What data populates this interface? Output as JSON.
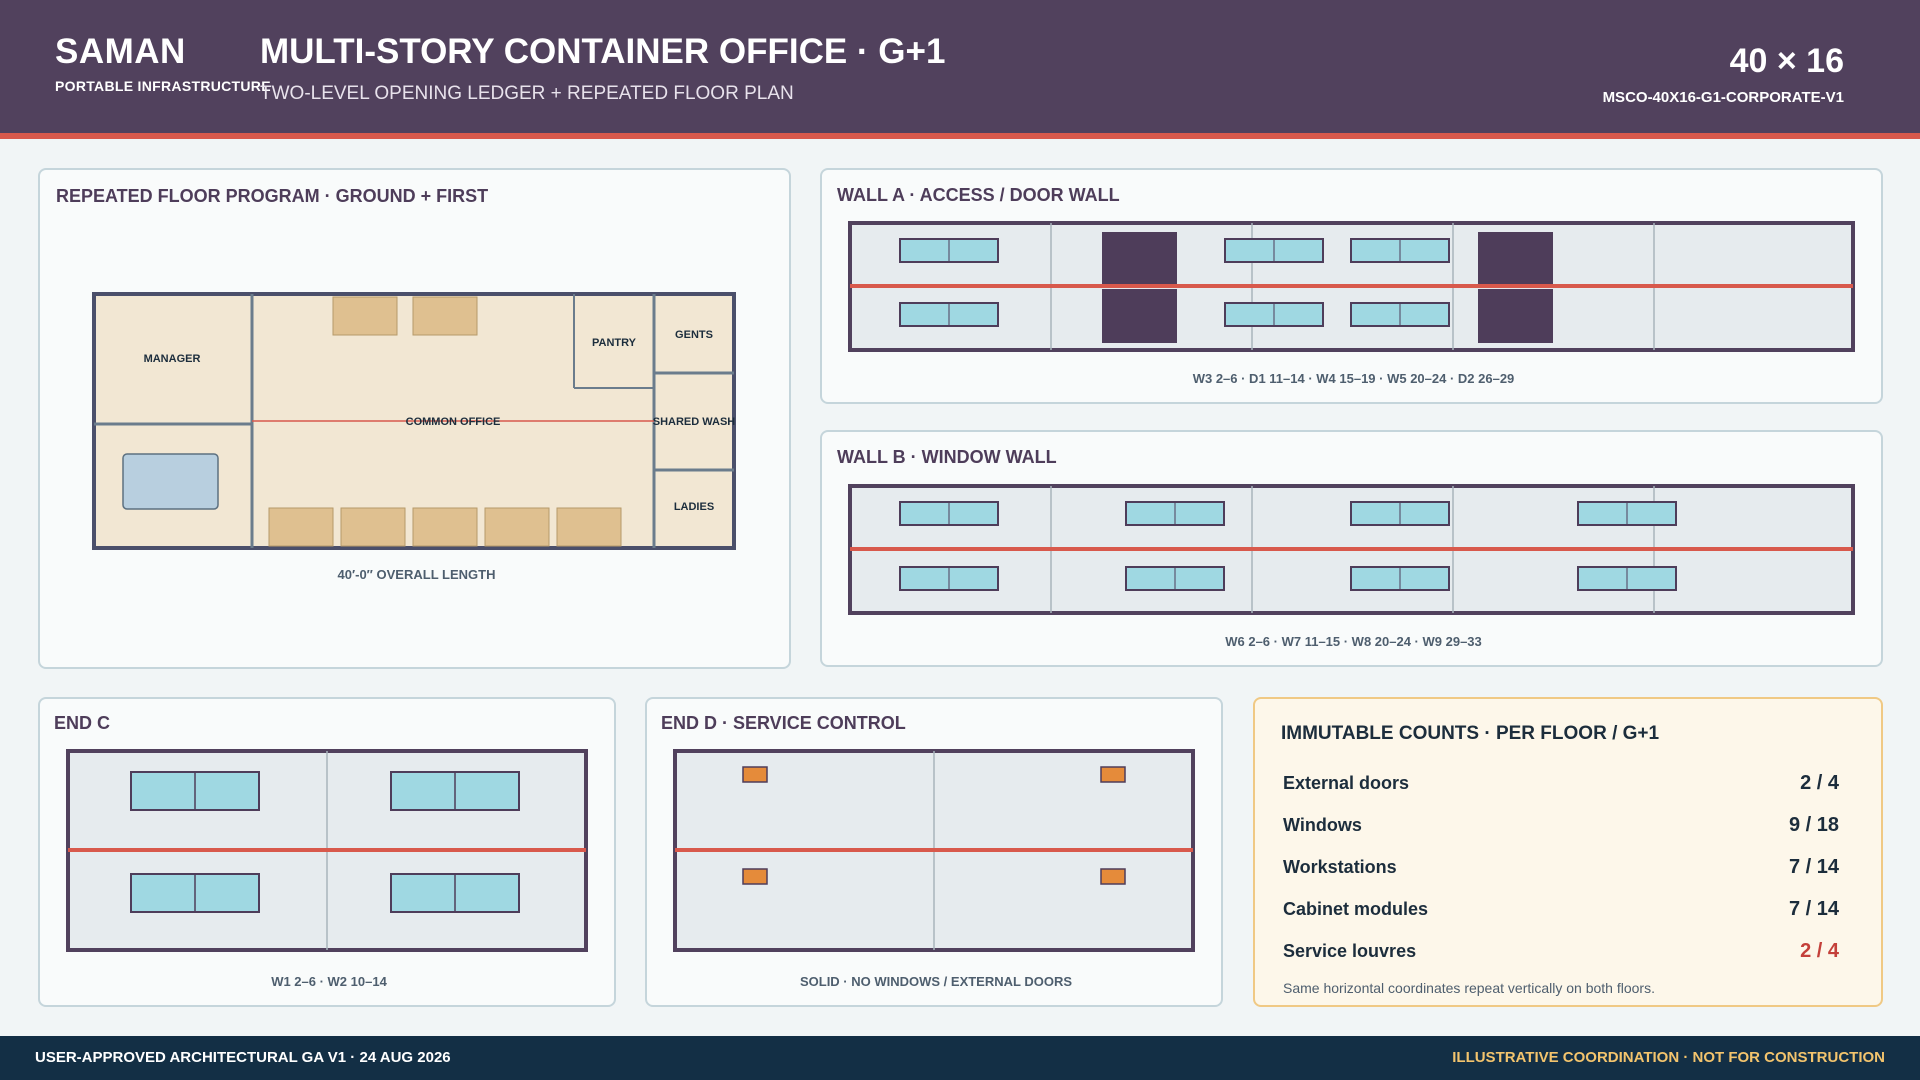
{
  "header": {
    "brand": "SAMAN",
    "brand_sub": "PORTABLE INFRASTRUCTURE",
    "title": "MULTI-STORY CONTAINER OFFICE · G+1",
    "subtitle": "TWO-LEVEL OPENING LEDGER + REPEATED FLOOR PLAN",
    "size": "40 × 16",
    "code": "MSCO-40X16-G1-CORPORATE-V1"
  },
  "floor_plan": {
    "title": "REPEATED FLOOR PROGRAM · GROUND + FIRST",
    "rooms": {
      "manager": "MANAGER",
      "common": "COMMON OFFICE",
      "pantry": "PANTRY",
      "gents": "GENTS",
      "shared_wash": "SHARED WASH",
      "ladies": "LADIES"
    },
    "caption": "40′-0″ OVERALL LENGTH"
  },
  "wall_a": {
    "title": "WALL A · ACCESS / DOOR WALL",
    "caption": "W3 2–6 · D1 11–14 · W4 15–19 · W5 20–24 · D2 26–29"
  },
  "wall_b": {
    "title": "WALL B · WINDOW WALL",
    "caption": "W6 2–6 · W7 11–15 · W8 20–24 · W9 29–33"
  },
  "end_c": {
    "title": "END C",
    "caption": "W1 2–6 · W2 10–14"
  },
  "end_d": {
    "title": "END D · SERVICE CONTROL",
    "caption": "SOLID · NO WINDOWS / EXTERNAL DOORS"
  },
  "counts": {
    "title": "IMMUTABLE COUNTS · PER FLOOR / G+1",
    "rows": [
      {
        "label": "External doors",
        "value": "2 / 4"
      },
      {
        "label": "Windows",
        "value": "9 / 18"
      },
      {
        "label": "Workstations",
        "value": "7 / 14"
      },
      {
        "label": "Cabinet modules",
        "value": "7 / 14"
      },
      {
        "label": "Service louvres",
        "value": "2 / 4"
      }
    ],
    "note": "Same horizontal coordinates repeat vertically on both floors."
  },
  "footer": {
    "left": "USER-APPROVED ARCHITECTURAL GA V1 · 24 AUG 2026",
    "right": "ILLUSTRATIVE COORDINATION · NOT FOR CONSTRUCTION"
  },
  "colors": {
    "header_bg": "#51415d",
    "accent_red": "#d8594c",
    "footer_bg": "#132f45",
    "footer_warning": "#f3c46d",
    "window_fill": "#9fd8e2",
    "door_fill": "#4e3d5a",
    "louvre_fill": "#e58b3a",
    "room_fill": "#f2e7d3",
    "desk_fill": "#dfc090"
  }
}
